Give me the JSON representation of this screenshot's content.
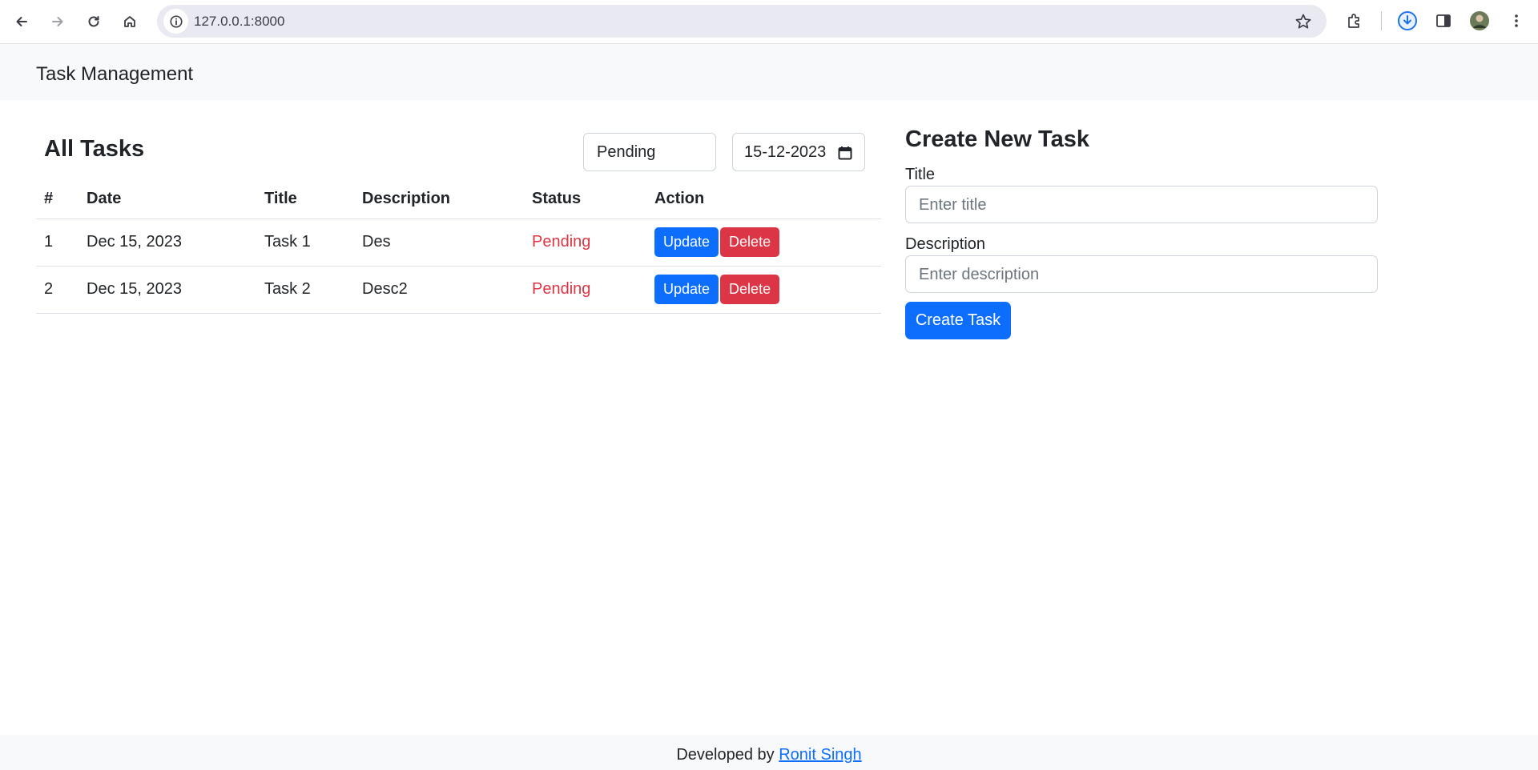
{
  "browser": {
    "url": "127.0.0.1:8000"
  },
  "navbar": {
    "brand": "Task Management"
  },
  "tasks_section": {
    "title": "All Tasks",
    "status_filter": "Pending",
    "date_filter": "15-12-2023",
    "columns": [
      "#",
      "Date",
      "Title",
      "Description",
      "Status",
      "Action"
    ],
    "rows": [
      {
        "num": "1",
        "date": "Dec 15, 2023",
        "title": "Task 1",
        "description": "Des",
        "status": "Pending"
      },
      {
        "num": "2",
        "date": "Dec 15, 2023",
        "title": "Task 2",
        "description": "Desc2",
        "status": "Pending"
      }
    ],
    "update_label": "Update",
    "delete_label": "Delete"
  },
  "create_form": {
    "title": "Create New Task",
    "title_label": "Title",
    "title_placeholder": "Enter title",
    "description_label": "Description",
    "description_placeholder": "Enter description",
    "submit_label": "Create Task"
  },
  "footer": {
    "text": "Developed by",
    "author": "Ronit Singh"
  },
  "colors": {
    "primary": "#0d6efd",
    "danger": "#dc3545",
    "light_bg": "#f8f9fa"
  }
}
